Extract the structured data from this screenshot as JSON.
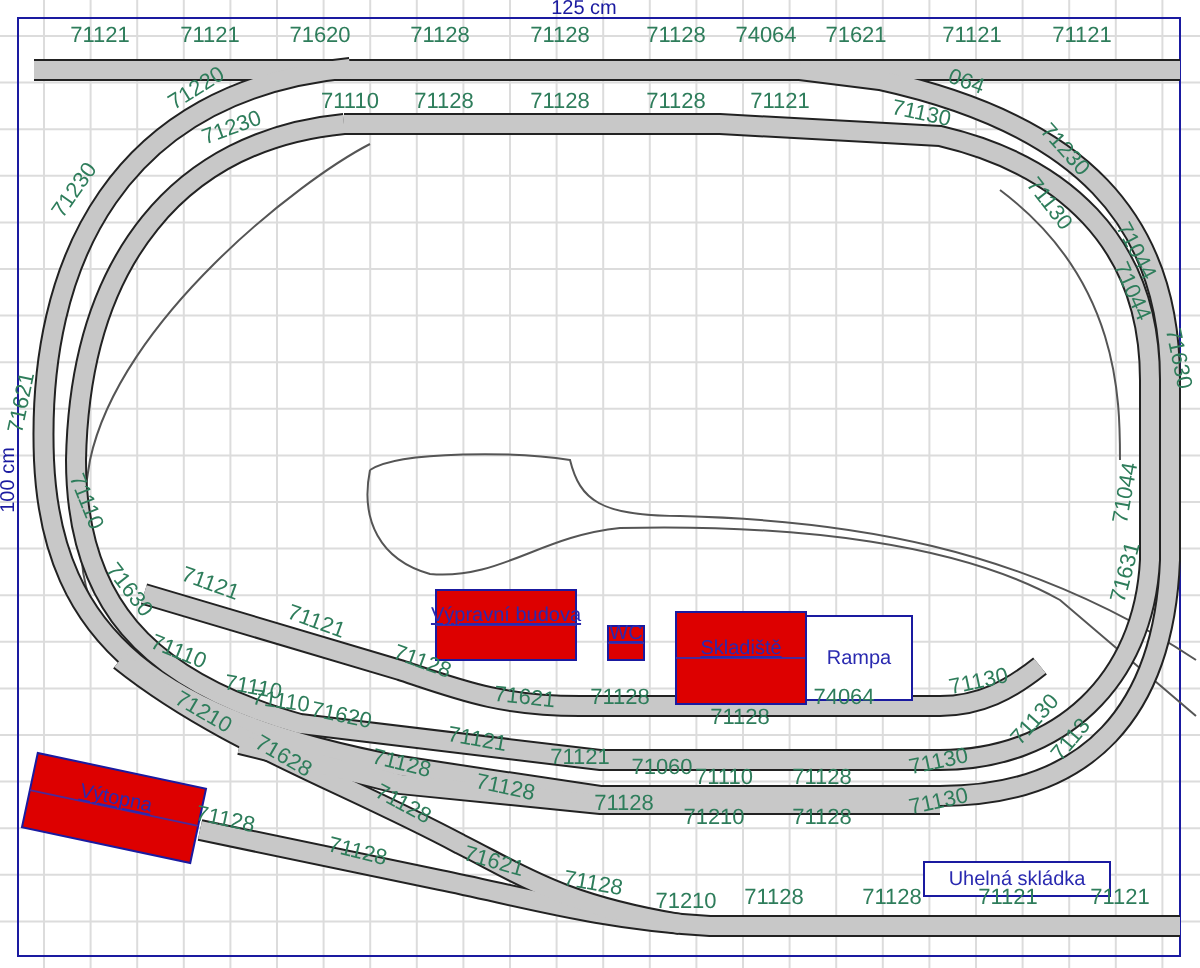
{
  "dimensions": {
    "width_label": "125 cm",
    "height_label": "100 cm"
  },
  "track_labels": [
    "71121",
    "71121",
    "71620",
    "71128",
    "71128",
    "71128",
    "74064",
    "71621",
    "71121",
    "71121",
    "71220",
    "71110",
    "71128",
    "71128",
    "71128",
    "71121",
    "71130",
    "064",
    "71230",
    "71230",
    "71230",
    "71130",
    "71044",
    "71044",
    "71630",
    "71621",
    "71110",
    "71044",
    "71631",
    "71630",
    "71121",
    "71121",
    "71128",
    "71621",
    "71110",
    "71110",
    "71110",
    "71210",
    "71620",
    "71121",
    "71628",
    "71128",
    "71128",
    "71128",
    "71128",
    "71128",
    "71621",
    "71128",
    "71210",
    "71128",
    "71128",
    "71121",
    "71121",
    "71128",
    "71128",
    "74064",
    "71130",
    "71121",
    "71060",
    "71110",
    "71128",
    "71130",
    "71128",
    "71210",
    "71128",
    "71130",
    "71130",
    "7113"
  ],
  "buildings": [
    {
      "name": "Výpravní budova",
      "kind": "building"
    },
    {
      "name": "WC",
      "kind": "building"
    },
    {
      "name": "Skladiště",
      "kind": "building"
    },
    {
      "name": "Rampa",
      "kind": "area"
    },
    {
      "name": "Výtopna",
      "kind": "building"
    },
    {
      "name": "Uhelná skládka",
      "kind": "area"
    }
  ]
}
